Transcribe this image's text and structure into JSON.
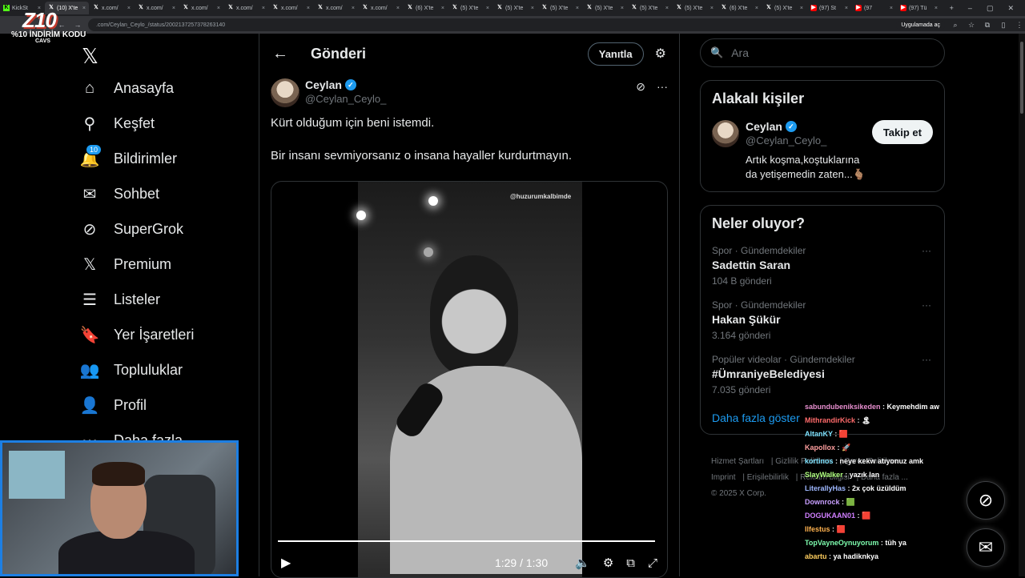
{
  "browser": {
    "tabs": [
      {
        "label": "KickSt",
        "icon": "kick"
      },
      {
        "label": "(10) X'te",
        "icon": "x",
        "active": true
      },
      {
        "label": "x.com/",
        "icon": "x"
      },
      {
        "label": "x.com/",
        "icon": "x"
      },
      {
        "label": "x.com/",
        "icon": "x"
      },
      {
        "label": "x.com/",
        "icon": "x"
      },
      {
        "label": "x.com/",
        "icon": "x"
      },
      {
        "label": "x.com/",
        "icon": "x"
      },
      {
        "label": "x.com/",
        "icon": "x"
      },
      {
        "label": "(6) X'te",
        "icon": "x"
      },
      {
        "label": "(5) X'te",
        "icon": "x"
      },
      {
        "label": "(5) X'te",
        "icon": "x"
      },
      {
        "label": "(5) X'te",
        "icon": "x"
      },
      {
        "label": "(5) X'te",
        "icon": "x"
      },
      {
        "label": "(5) X'te",
        "icon": "x"
      },
      {
        "label": "(5) X'te",
        "icon": "x"
      },
      {
        "label": "(6) X'te",
        "icon": "x"
      },
      {
        "label": "(5) X'te",
        "icon": "x"
      },
      {
        "label": "(97) St",
        "icon": "yt"
      },
      {
        "label": "(97",
        "icon": "yt"
      },
      {
        "label": "(97) Tü",
        "icon": "yt"
      }
    ],
    "url": ".com/Ceylan_Ceylo_/status/2002137257378263140",
    "app_pill": "Uygulamada aç"
  },
  "stream_overlay": {
    "logo": "Z10",
    "promo": "%10 İNDİRİM KODU",
    "code": "CAVS"
  },
  "nav": {
    "items": [
      {
        "label": "Anasayfa",
        "icon": "home-icon"
      },
      {
        "label": "Keşfet",
        "icon": "search-icon"
      },
      {
        "label": "Bildirimler",
        "icon": "bell-icon",
        "badge": "10"
      },
      {
        "label": "Sohbet",
        "icon": "mail-icon"
      },
      {
        "label": "SuperGrok",
        "icon": "grok-icon"
      },
      {
        "label": "Premium",
        "icon": "x-icon"
      },
      {
        "label": "Listeler",
        "icon": "list-icon"
      },
      {
        "label": "Yer İşaretleri",
        "icon": "bookmark-icon"
      },
      {
        "label": "Topluluklar",
        "icon": "communities-icon"
      },
      {
        "label": "Profil",
        "icon": "profile-icon"
      },
      {
        "label": "Daha fazla",
        "icon": "more-icon"
      }
    ]
  },
  "header": {
    "title": "Gönderi",
    "reply_label": "Yanıtla"
  },
  "post": {
    "display_name": "Ceylan",
    "handle": "@Ceylan_Ceylo_",
    "lines": [
      "Kürt olduğum için beni istemdi.",
      "Bir insanı sevmiyorsanız o insana hayaller kurdurtmayın."
    ],
    "watermark": "@huzurumkalbimde",
    "time": "1:29 / 1:30",
    "progress": 0.989
  },
  "search": {
    "placeholder": "Ara"
  },
  "related": {
    "title": "Alakalı kişiler",
    "name": "Ceylan",
    "handle": "@Ceylan_Ceylo_",
    "bio": "Artık koşma,koştuklarına da yetişemedin zaten...🫰🏽",
    "follow_label": "Takip et"
  },
  "trends": {
    "title": "Neler oluyor?",
    "items": [
      {
        "meta": "Spor · Gündemdekiler",
        "name": "Sadettin Saran",
        "count": "104 B gönderi"
      },
      {
        "meta": "Spor · Gündemdekiler",
        "name": "Hakan Şükür",
        "count": "3.164 gönderi"
      },
      {
        "meta": "Popüler videolar · Gündemdekiler",
        "name": "#ÜmraniyeBelediyesi",
        "count": "7.035 gönderi"
      }
    ],
    "show_more": "Daha fazla göster"
  },
  "footer": {
    "links": [
      "Hizmet Şartları",
      "Gizlilik Politikası",
      "Çerez Politikası",
      "Imprint",
      "Erişilebilirlik",
      "Reklam bilgisi",
      "Daha fazla ..."
    ],
    "copyright": "© 2025 X Corp."
  },
  "chat": [
    {
      "user": "sabundubeniksikeden",
      "msg": "Keymehdim aw",
      "color": "#e88fd0"
    },
    {
      "user": "MithrandirKick",
      "msg": "🏝",
      "color": "#ff6b6b"
    },
    {
      "user": "AltanKY",
      "msg": "🟥",
      "color": "#7fe3ff"
    },
    {
      "user": "Kapollox",
      "msg": "🚀",
      "color": "#ff9f9f"
    },
    {
      "user": "kortinos",
      "msg": "neye kekw atıyonuz amk",
      "color": "#7fe3ff"
    },
    {
      "user": "SlayWalker",
      "msg": "yazık lan",
      "color": "#b0ff7f"
    },
    {
      "user": "LiterallyHas",
      "msg": "2x çok üzüldüm",
      "color": "#9fb8ff"
    },
    {
      "user": "Downrock",
      "msg": "🟩",
      "color": "#c89fff"
    },
    {
      "user": "DOGUKAAN01",
      "msg": "🟥",
      "color": "#d07fff"
    },
    {
      "user": "Ilfestus",
      "msg": "🟥",
      "color": "#ffb24f"
    },
    {
      "user": "TopVayneOynuyorum",
      "msg": "tüh ya",
      "color": "#7fffb0"
    },
    {
      "user": "abartu",
      "msg": "ya hadiknkya",
      "color": "#ffcf5f"
    }
  ],
  "colors": {
    "accent": "#1d9bf0",
    "webcam_border": "#1d7fe3"
  }
}
